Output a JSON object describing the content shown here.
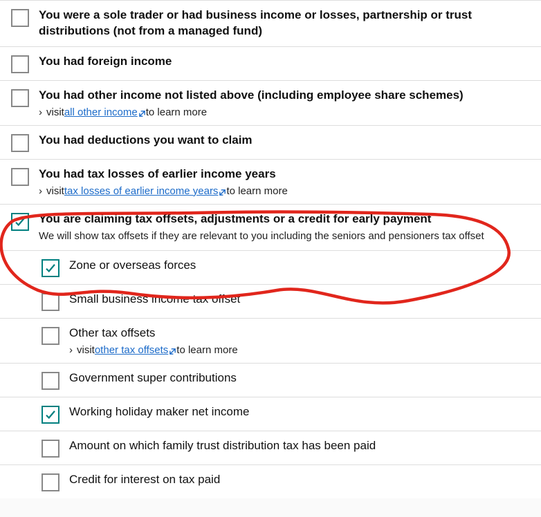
{
  "items": [
    {
      "label": "You were a sole trader or had business income or losses, partnership or trust distributions (not from a managed fund)",
      "checked": false
    },
    {
      "label": "You had foreign income",
      "checked": false
    },
    {
      "label": "You had other income not listed above (including employee share schemes)",
      "checked": false,
      "visit_prefix": "visit ",
      "visit_link": "all other income",
      "visit_suffix": " to learn more"
    },
    {
      "label": "You had deductions you want to claim",
      "checked": false
    },
    {
      "label": "You had tax losses of earlier income years",
      "checked": false,
      "visit_prefix": "visit ",
      "visit_link": "tax losses of earlier income years",
      "visit_suffix": " to learn more"
    },
    {
      "label": "You are claiming tax offsets, adjustments or a credit for early payment",
      "sublabel": "We will show tax offsets if they are relevant to you including the seniors and pensioners tax offset",
      "checked": true
    },
    {
      "label": "Zone or overseas forces",
      "checked": true,
      "nested": true,
      "normal": true
    },
    {
      "label": "Small business income tax offset",
      "checked": false,
      "nested": true,
      "normal": true
    },
    {
      "label": "Other tax offsets",
      "checked": false,
      "nested": true,
      "normal": true,
      "visit_prefix": "visit ",
      "visit_link": "other tax offsets",
      "visit_suffix": " to learn more"
    },
    {
      "label": "Government super contributions",
      "checked": false,
      "nested": true,
      "normal": true
    },
    {
      "label": "Working holiday maker net income",
      "checked": true,
      "nested": true,
      "normal": true
    },
    {
      "label": "Amount on which family trust distribution tax has been paid",
      "checked": false,
      "nested": true,
      "normal": true
    },
    {
      "label": "Credit for interest on tax paid",
      "checked": false,
      "nested": true,
      "normal": true
    }
  ]
}
